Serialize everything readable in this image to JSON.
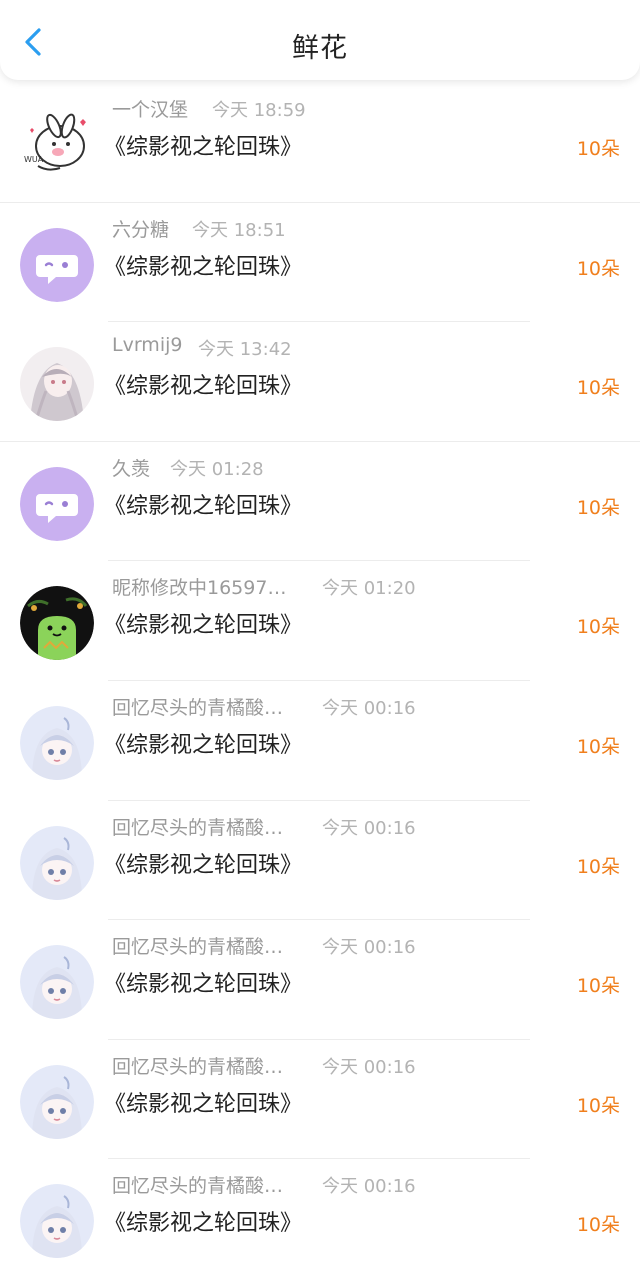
{
  "header": {
    "title": "鲜花",
    "back_icon": "chevron-left-icon",
    "accent": "#2b9ef0"
  },
  "rows": [
    {
      "name": "一个汉堡",
      "time": "今天 18:59",
      "book": "《综影视之轮回珠》",
      "count": "10朵",
      "avatar": "cartoon-bunny-avatar"
    },
    {
      "name": "六分糖",
      "time": "今天 18:51",
      "book": "《综影视之轮回珠》",
      "count": "10朵",
      "avatar": "default-chat-avatar"
    },
    {
      "name": "Lvrmij9",
      "time": "今天 13:42",
      "book": "《综影视之轮回珠》",
      "count": "10朵",
      "avatar": "anime-girl-avatar"
    },
    {
      "name": "久羡",
      "time": "今天 01:28",
      "book": "《综影视之轮回珠》",
      "count": "10朵",
      "avatar": "default-chat-avatar"
    },
    {
      "name": "昵称修改中16597…",
      "time": "今天 01:20",
      "book": "《综影视之轮回珠》",
      "count": "10朵",
      "avatar": "green-creature-avatar"
    },
    {
      "name": "回忆尽头的青橘酸…",
      "time": "今天 00:16",
      "book": "《综影视之轮回珠》",
      "count": "10朵",
      "avatar": "chibi-girl-avatar"
    },
    {
      "name": "回忆尽头的青橘酸…",
      "time": "今天 00:16",
      "book": "《综影视之轮回珠》",
      "count": "10朵",
      "avatar": "chibi-girl-avatar"
    },
    {
      "name": "回忆尽头的青橘酸…",
      "time": "今天 00:16",
      "book": "《综影视之轮回珠》",
      "count": "10朵",
      "avatar": "chibi-girl-avatar"
    },
    {
      "name": "回忆尽头的青橘酸…",
      "time": "今天 00:16",
      "book": "《综影视之轮回珠》",
      "count": "10朵",
      "avatar": "chibi-girl-avatar"
    },
    {
      "name": "回忆尽头的青橘酸…",
      "time": "今天 00:16",
      "book": "《综影视之轮回珠》",
      "count": "10朵",
      "avatar": "chibi-girl-avatar"
    }
  ],
  "colors": {
    "count": "#f07f1d",
    "name": "#9a9a9a",
    "time": "#b3b3b3",
    "default_avatar": "#c9b0f0"
  }
}
